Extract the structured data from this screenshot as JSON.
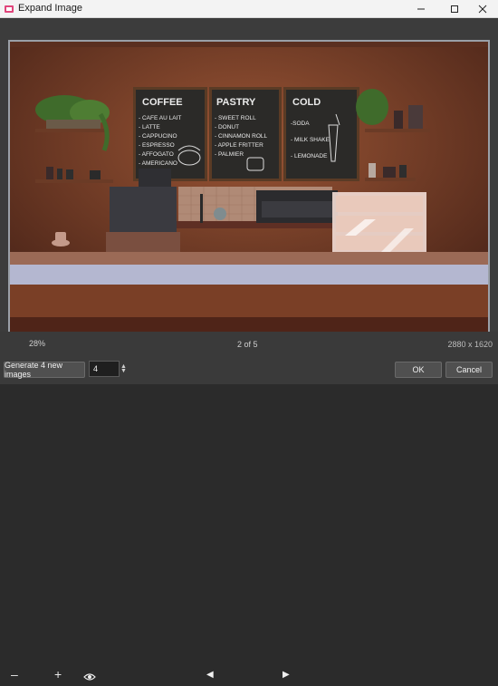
{
  "window": {
    "title": "Expand Image"
  },
  "toolbar": {
    "zoom_out_symbol": "–",
    "zoom_value": "28%",
    "zoom_in_symbol": "+",
    "prev_symbol": "◀",
    "page": "2 of 5",
    "next_symbol": "▶",
    "dimensions": "2880 x 1620"
  },
  "bottom": {
    "generate_label": "Generate 4 new images",
    "count_value": "4",
    "ok_label": "OK",
    "cancel_label": "Cancel"
  },
  "scene": {
    "board1": {
      "title": "COFFEE",
      "items": [
        "- CAFE AU LAIT",
        "- LATTE",
        "- CAPPUCINO",
        "- ESPRESSO",
        "- AFFOGATO",
        "- AMERICANO"
      ]
    },
    "board2": {
      "title": "PASTRY",
      "items": [
        "- SWEET ROLL",
        "- DONUT",
        "- CINNAMON ROLL",
        "- APPLE FRITTER",
        "- PALMIER"
      ]
    },
    "board3": {
      "title": "COLD",
      "items": [
        "-SODA",
        "- MILK SHAKE",
        "- LEMONADE"
      ]
    }
  },
  "colors": {
    "accent": "#e0457b",
    "panel": "#3a3a3a",
    "wall": "#7a3f26"
  },
  "icons": {
    "eye": "eye-icon",
    "app": "app-icon"
  }
}
